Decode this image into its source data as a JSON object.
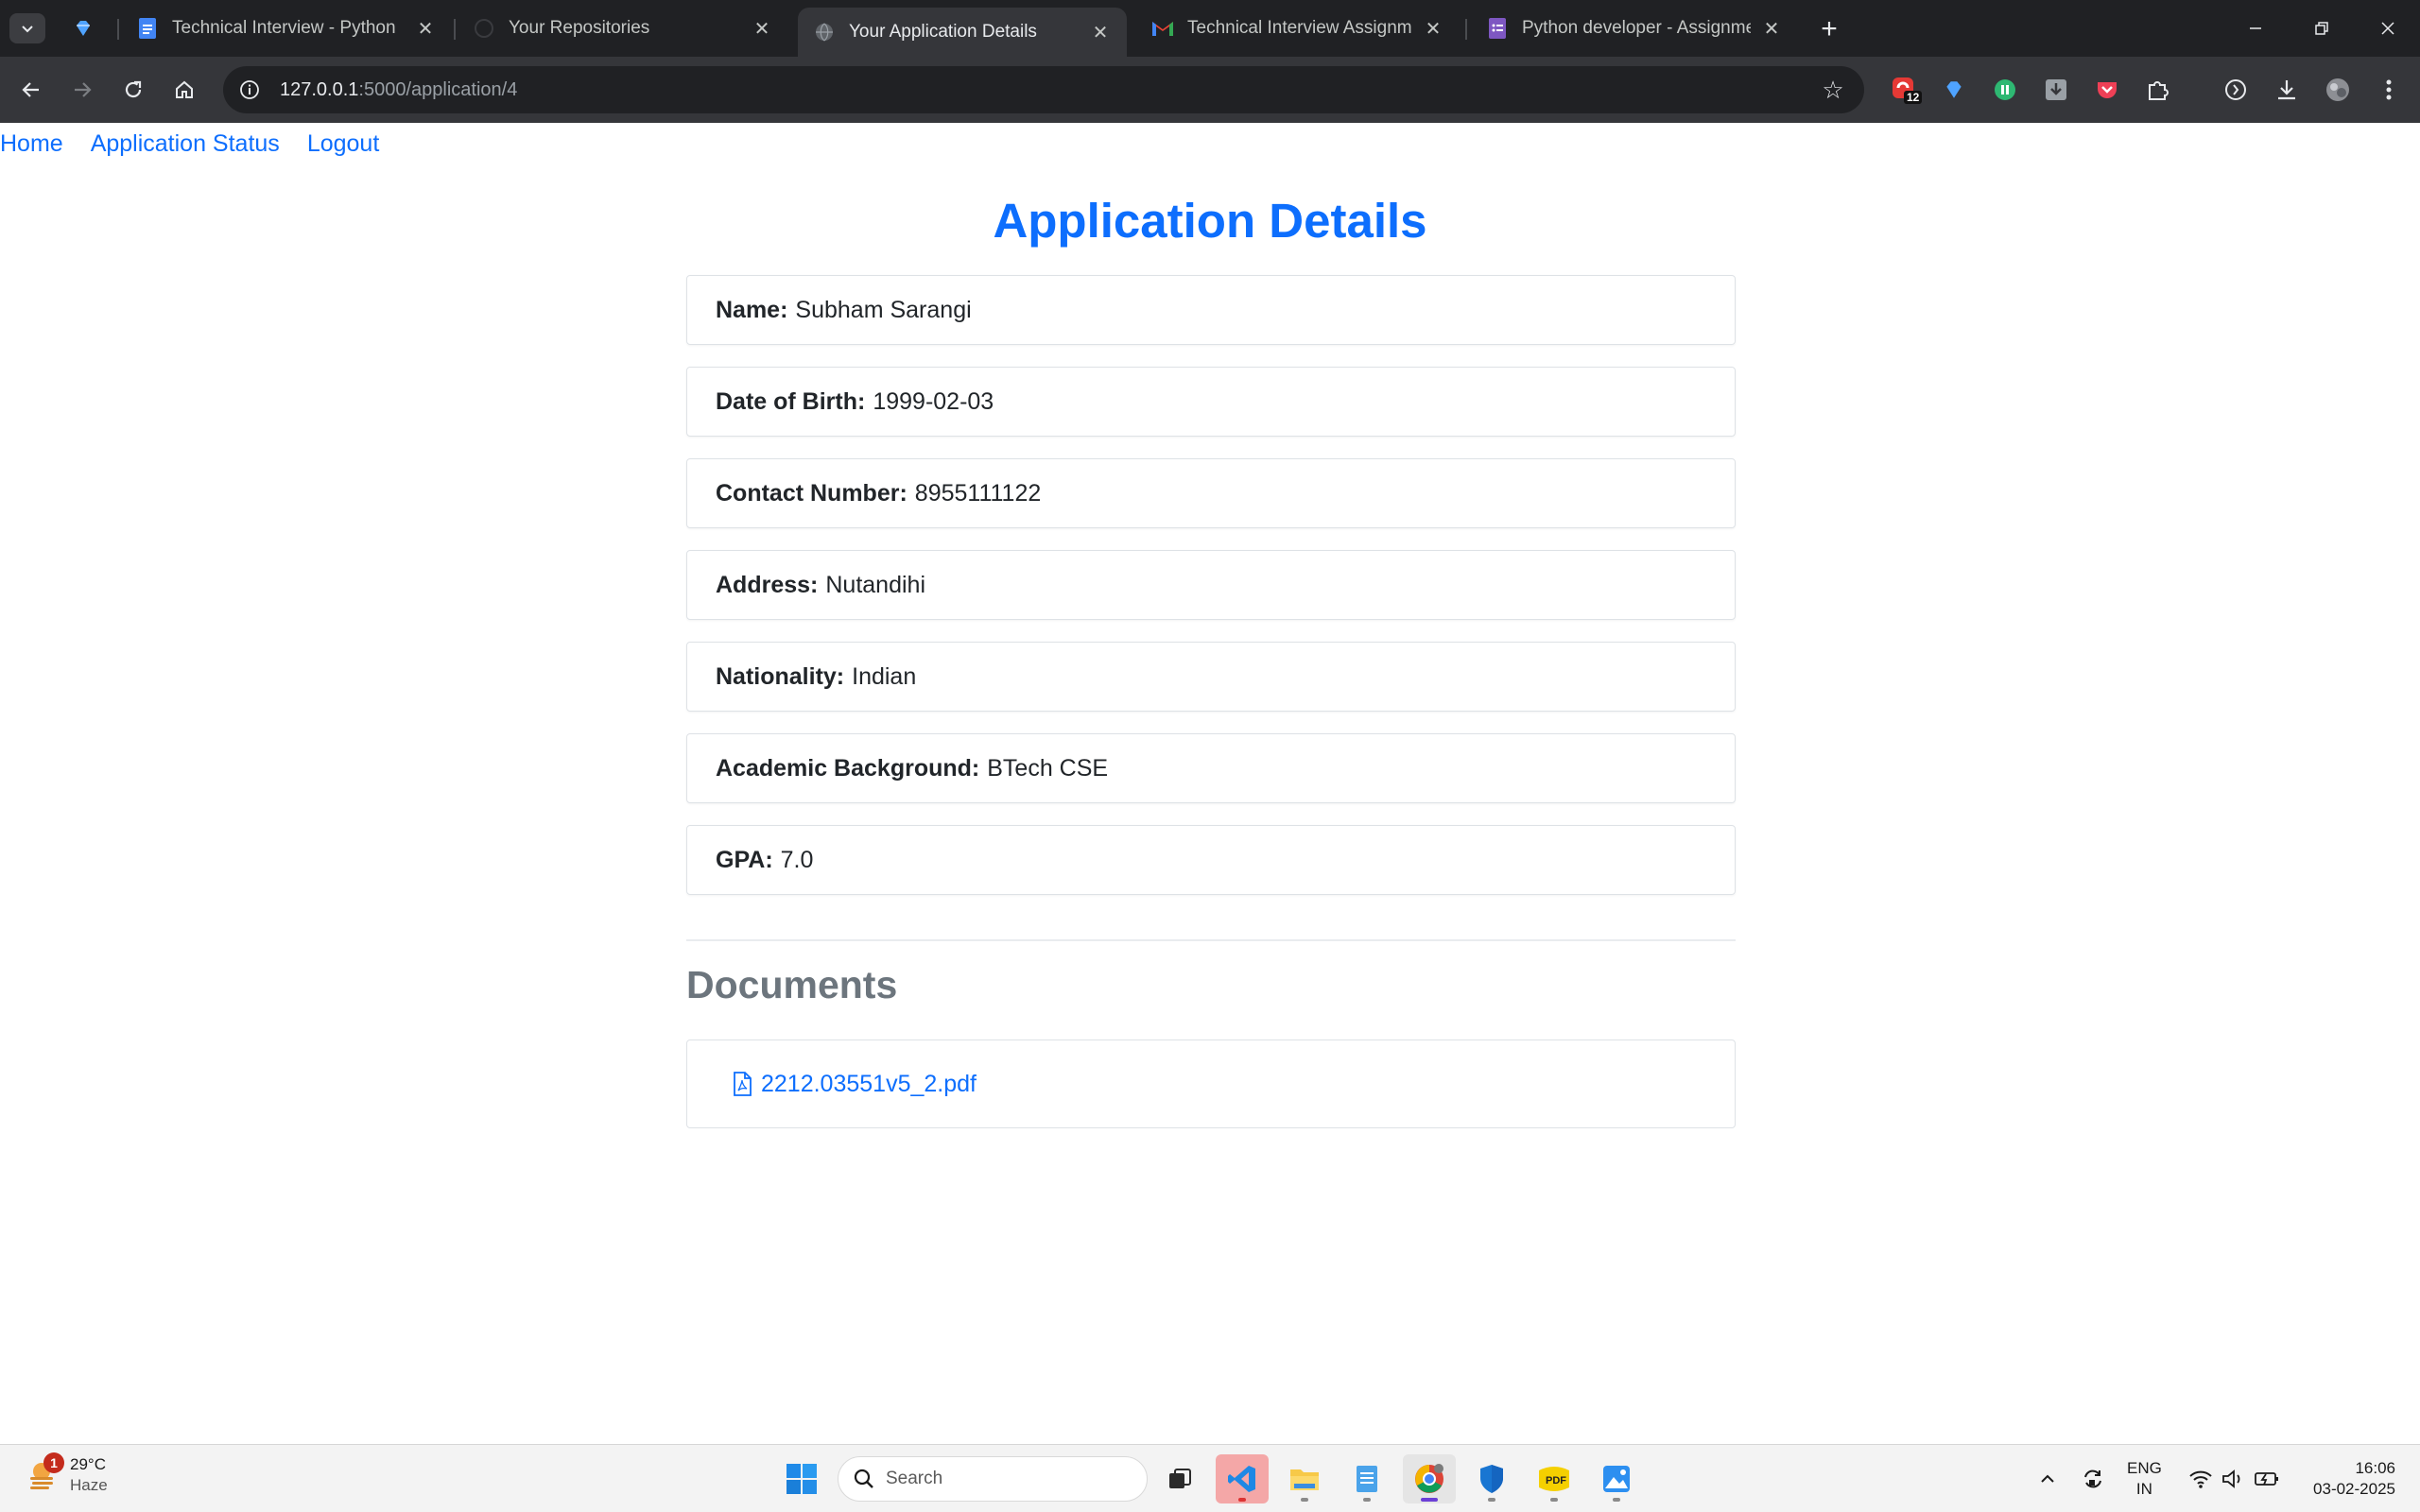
{
  "browser": {
    "tabs": [
      {
        "title": "Technical Interview - Python",
        "favicon": "docs-icon",
        "active": false
      },
      {
        "title": "Your Repositories",
        "favicon": "github-icon",
        "active": false
      },
      {
        "title": "Your Application Details",
        "favicon": "globe-icon",
        "active": true
      },
      {
        "title": "Technical Interview Assignment",
        "favicon": "gmail-icon",
        "active": false
      },
      {
        "title": "Python developer - Assignment",
        "favicon": "forms-icon",
        "active": false
      }
    ],
    "url_host": "127.0.0.1",
    "url_path": ":5000/application/4",
    "extension_badge": "12",
    "colors": {
      "chrome_dark": "#202124",
      "chrome_toolbar": "#35363a"
    }
  },
  "nav": {
    "home": "Home",
    "status": "Application Status",
    "logout": "Logout"
  },
  "page_title": "Application Details",
  "details": [
    {
      "label": "Name:",
      "value": "Subham Sarangi"
    },
    {
      "label": "Date of Birth:",
      "value": "1999-02-03"
    },
    {
      "label": "Contact Number:",
      "value": "8955111122"
    },
    {
      "label": "Address:",
      "value": "Nutandihi"
    },
    {
      "label": "Nationality:",
      "value": "Indian"
    },
    {
      "label": "Academic Background:",
      "value": "BTech CSE"
    },
    {
      "label": "GPA:",
      "value": "7.0"
    }
  ],
  "documents": {
    "title": "Documents",
    "files": [
      "2212.03551v5_2.pdf"
    ]
  },
  "taskbar": {
    "weather_temp": "29°C",
    "weather_cond": "Haze",
    "weather_badge": "1",
    "search_placeholder": "Search",
    "lang_top": "ENG",
    "lang_bottom": "IN",
    "time": "16:06",
    "date": "03-02-2025"
  },
  "colors": {
    "link": "#0d6efd",
    "heading_gray": "#6c757d",
    "card_border": "#dee2e6"
  }
}
